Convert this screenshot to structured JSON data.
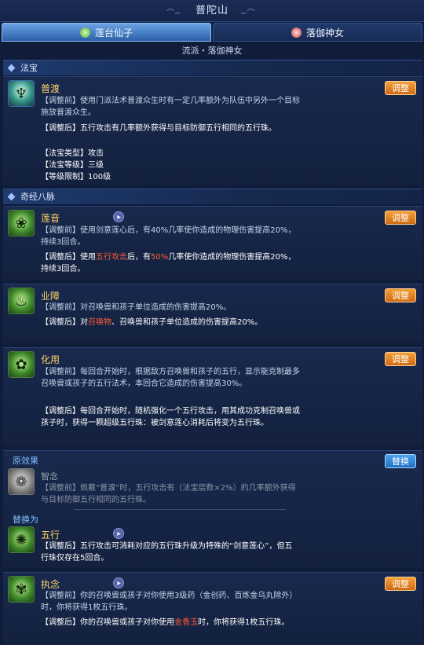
{
  "header": {
    "title": "普陀山"
  },
  "tabs": [
    {
      "label": "莲台仙子",
      "active": true
    },
    {
      "label": "落伽神女",
      "active": false
    }
  ],
  "subtitle": "流派・落伽神女",
  "colors": {
    "accent_orange": "#e2801f",
    "highlight_red": "#ff5a3a",
    "name_gold": "#ffd36a",
    "swap_blue": "#2f86d8"
  },
  "sections": {
    "fabao": "法宝",
    "qijing": "奇经八脉"
  },
  "fabao": {
    "name": "普渡",
    "button": "调整",
    "before": "【调整前】使用门派法术普渡众生时有一定几率额外为队伍中另外一个目标施放普渡众生。",
    "after": "【调整后】五行攻击有几率额外获得与目标防御五行相同的五行珠。",
    "type": "【法宝类型】攻击",
    "level": "【法宝等级】三级",
    "limit": "【等级限制】100级"
  },
  "skills": [
    {
      "name": "莲音",
      "button": "调整",
      "before": "【调整前】使用剑意莲心后，有40%几率使你造成的物理伤害提高20%，持续3回合。",
      "after_1": "【调整后】使用",
      "after_hl1": "五行攻击",
      "after_2": "后，有",
      "after_hl2": "50%",
      "after_3": "几率使你造成的物理伤害提高20%，持续3回合。"
    },
    {
      "name": "业障",
      "button": "调整",
      "before": "【调整前】对召唤兽和孩子单位造成的伤害提高20%。",
      "after_1": "【调整后】对",
      "after_hl1": "召唤物",
      "after_2": "、召唤兽和孩子单位造成的伤害提高20%。"
    },
    {
      "name": "化用",
      "button": "调整",
      "before": "【调整前】每回合开始时，根据敌方召唤兽和孩子的五行，显示能克制最多召唤兽或孩子的五行法术，本回合它造成的伤害提高30%。",
      "after": "【调整后】每回合开始时，随机强化一个五行攻击，用其成功克制召唤兽或孩子时，获得一颗超级五行珠：被剑意莲心消耗后将变为五行珠。"
    }
  ],
  "swap": {
    "original_label": "原效果",
    "button": "替换",
    "original_name": "智念",
    "original_text": "【调整前】佩戴“普渡”时，五行攻击有（法宝层数×2%）的几率额外获得与目标防御五行相同的五行珠。",
    "replace_label": "替换为",
    "new_name": "五行",
    "new_text": "【调整后】五行攻击可消耗对应的五行珠升级为特殊的“剑意莲心”，但五行珠仅存在5回合。"
  },
  "last": {
    "name": "执念",
    "button": "调整",
    "before": "【调整前】你的召唤兽或孩子对你使用3级药（金创药、百炼金乌丸除外）时，你将获得1枚五行珠。",
    "after_1": "【调整后】你的召唤兽或孩子对你使用",
    "after_hl": "金香玉",
    "after_2": "时，你将获得1枚五行珠。"
  }
}
